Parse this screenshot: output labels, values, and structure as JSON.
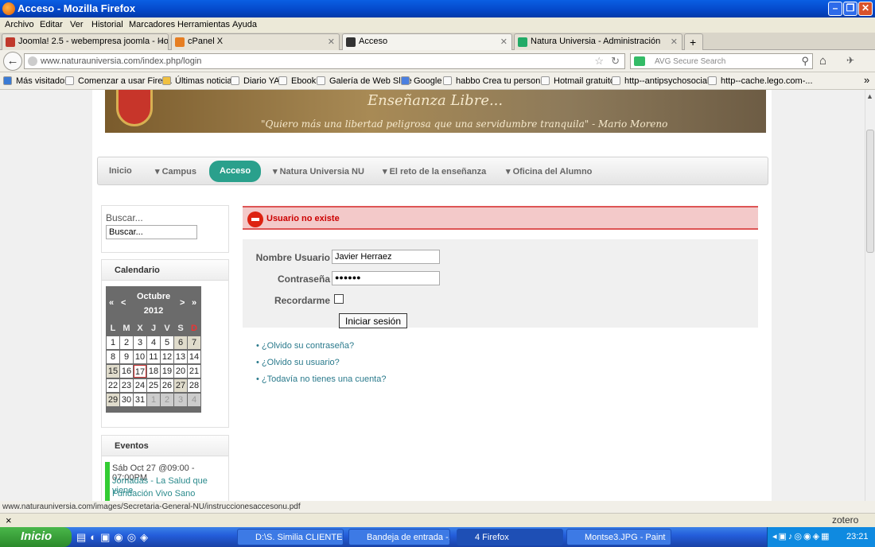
{
  "window": {
    "title": "Acceso - Mozilla Firefox"
  },
  "menu": [
    "Archivo",
    "Editar",
    "Ver",
    "Historial",
    "Marcadores",
    "Herramientas",
    "Ayuda"
  ],
  "tabs": [
    {
      "label": "Joomla! 2.5 - webempresa joomla - Hosti...",
      "color": "#c0392b"
    },
    {
      "label": "cPanel X",
      "color": "#e67e22"
    },
    {
      "label": "Acceso",
      "color": "#333"
    },
    {
      "label": "Natura Universia - Administración",
      "color": "#2a6"
    }
  ],
  "url": {
    "text": "www.naturauniversia.com/index.php/login"
  },
  "search": {
    "placeholder": "AVG Secure Search"
  },
  "bookmarks": [
    "Más visitados",
    "Comenzar a usar Firef...",
    "Últimas noticias",
    "Diario YA",
    "Ebook",
    "Galería de Web Slice",
    "Google",
    "habbo Crea tu person...",
    "Hotmail gratuito",
    "http--antipsychosocial...",
    "http--cache.lego.com-..."
  ],
  "banner": {
    "heading": "Enseñanza Libre...",
    "quote": "\"Quiero más una libertad peligrosa que una servidumbre tranquila\" - Mario Moreno"
  },
  "nav": [
    "Inicio",
    "Campus",
    "Acceso",
    "Natura Universia NU",
    "El reto de la enseñanza",
    "Oficina del Alumno"
  ],
  "sidebar": {
    "search_label": "Buscar...",
    "search_value": "Buscar...",
    "calendar_title": "Calendario",
    "month": "Octubre",
    "year": "2012",
    "prev_year": "«",
    "prev_month": "<",
    "next_month": ">",
    "next_year": "»",
    "days": [
      "L",
      "M",
      "X",
      "J",
      "V",
      "S",
      "D"
    ],
    "weeks": [
      [
        "1",
        "2",
        "3",
        "4",
        "5",
        "6",
        "7"
      ],
      [
        "8",
        "9",
        "10",
        "11",
        "12",
        "13",
        "14"
      ],
      [
        "15",
        "16",
        "17",
        "18",
        "19",
        "20",
        "21"
      ],
      [
        "22",
        "23",
        "24",
        "25",
        "26",
        "27",
        "28"
      ],
      [
        "29",
        "30",
        "31",
        "1",
        "2",
        "3",
        "4"
      ]
    ],
    "events_title": "Eventos",
    "event_date": "Sáb Oct 27 @09:00 - 07:00PM",
    "event_title": "Jornadas - La Salud que viene",
    "event_org": "Fundación Vivo Sano"
  },
  "login": {
    "error": "Usuario no existe",
    "user_label": "Nombre Usuario",
    "user_value": "Javier Herraez",
    "pass_label": "Contraseña",
    "pass_value": "●●●●●●",
    "remember_label": "Recordarme",
    "submit": "Iniciar sesión",
    "links": [
      "¿Olvido su contraseña?",
      "¿Olvido su usuario?",
      "¿Todavía no tienes una cuenta?"
    ]
  },
  "status": {
    "text": "www.naturauniversia.com/images/Secretaria-General-NU/instruccionesaccesonu.pdf"
  },
  "addon": {
    "close": "×",
    "zotero": "zotero"
  },
  "taskbar": {
    "start": "Inicio",
    "items": [
      "D:\\S. Similia CLIENTE....",
      "Bandeja de entrada -...",
      "4 Firefox",
      "Montse3.JPG - Paint"
    ],
    "clock": "23:21"
  }
}
